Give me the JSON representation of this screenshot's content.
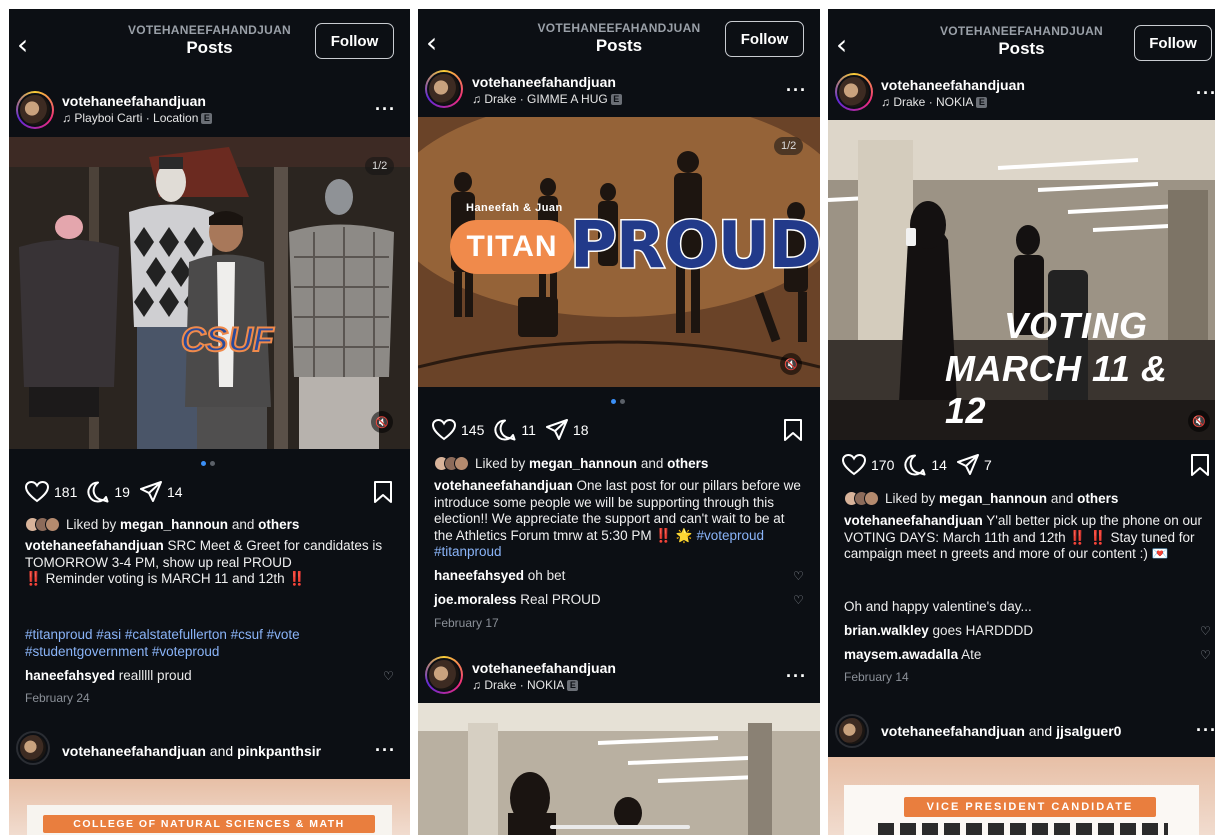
{
  "panels": [
    {
      "header": {
        "account": "VOTEHANEEFAHANDJUAN",
        "title": "Posts",
        "follow": "Follow"
      },
      "post": {
        "username": "votehaneefahandjuan",
        "music": "Playboi Carti · Location",
        "counter": "1/2",
        "image_text": "CSUF",
        "likes_count": "181",
        "comments_count": "19",
        "shares_count": "14",
        "liked_by_prefix": "Liked by ",
        "liked_by_user": "megan_hannoun",
        "liked_by_and": " and ",
        "liked_by_others": "others",
        "caption_user": "votehaneefahandjuan",
        "caption_line1": " SRC Meet & Greet for candidates is TOMORROW 3-4 PM, show up real PROUD",
        "caption_alert1": "‼️",
        "caption_line2": " Reminder voting is MARCH 11 and 12th ",
        "caption_alert2": "‼️",
        "hashtags": "#titanproud #asi #calstatefullerton #csuf #vote #studentgovernment #voteproud",
        "comments": [
          {
            "user": "haneefahsyed",
            "text": " realllll proud"
          }
        ],
        "date": "February 24"
      },
      "next": {
        "username": "votehaneefahandjuan",
        "and": " and ",
        "collab": "pinkpanthsir",
        "poster_text": "COLLEGE OF NATURAL SCIENCES & MATH"
      }
    },
    {
      "header": {
        "account": "VOTEHANEEFAHANDJUAN",
        "title": "Posts",
        "follow": "Follow"
      },
      "post": {
        "username": "votehaneefahandjuan",
        "music": "Drake · GIMME A HUG",
        "counter": "1/2",
        "image_small": "Haneefah & Juan",
        "image_pill": "TITAN",
        "image_big": "PROUD",
        "likes_count": "145",
        "comments_count": "11",
        "shares_count": "18",
        "liked_by_prefix": "Liked by ",
        "liked_by_user": "megan_hannoun",
        "liked_by_and": " and ",
        "liked_by_others": "others",
        "caption_user": "votehaneefahandjuan",
        "caption_text": " One last post for our pillars before we introduce some people we will be supporting through this election!! We appreciate the support and can't wait to be at the Athletics Forum tmrw at 5:30 PM ",
        "caption_emoji": "‼️ 🌟",
        "hashtags": " #voteproud #titanproud",
        "comments": [
          {
            "user": "haneefahsyed",
            "text": " oh bet"
          },
          {
            "user": "joe.moraless",
            "text": " Real PROUD"
          }
        ],
        "date": "February 17"
      },
      "next": {
        "username": "votehaneefahandjuan",
        "music": "Drake · NOKIA"
      }
    },
    {
      "header": {
        "account": "VOTEHANEEFAHANDJUAN",
        "title": "Posts",
        "follow": "Follow"
      },
      "post": {
        "username": "votehaneefahandjuan",
        "music": "Drake · NOKIA",
        "image_line1": "VOTING",
        "image_line2": "MARCH 11 & 12",
        "likes_count": "170",
        "comments_count": "14",
        "shares_count": "7",
        "liked_by_prefix": "Liked by ",
        "liked_by_user": "megan_hannoun",
        "liked_by_and": " and ",
        "liked_by_others": "others",
        "caption_user": "votehaneefahandjuan",
        "caption_text": " Y'all better pick up the phone on our VOTING DAYS: March 11th and 12th ",
        "caption_alert": "‼️ ‼️",
        "caption_text2": " Stay tuned for campaign meet n greets and more of our content :) ",
        "caption_emoji": "💌",
        "caption_extra": "Oh and happy valentine's day...",
        "comments": [
          {
            "user": "brian.walkley",
            "text": " goes HARDDDD"
          },
          {
            "user": "maysem.awadalla",
            "text": " Ate"
          }
        ],
        "date": "February 14"
      },
      "next": {
        "username": "votehaneefahandjuan",
        "and": " and ",
        "collab": "jjsalguer0",
        "poster_text": "VICE PRESIDENT CANDIDATE"
      }
    }
  ],
  "icons": {
    "back": "chevron-left-icon",
    "more": "more-dots-icon",
    "music": "music-note-icon",
    "heart": "heart-icon",
    "comment": "comment-icon",
    "share": "share-icon",
    "bookmark": "bookmark-icon",
    "mute": "mute-icon"
  },
  "colors": {
    "background": "#0c0f14",
    "hashtag": "#8ab4f8",
    "alert": "#e23b3b",
    "indicator": "#3b8ff6",
    "pill": "#f08a4b",
    "proud": "#223a8a"
  }
}
